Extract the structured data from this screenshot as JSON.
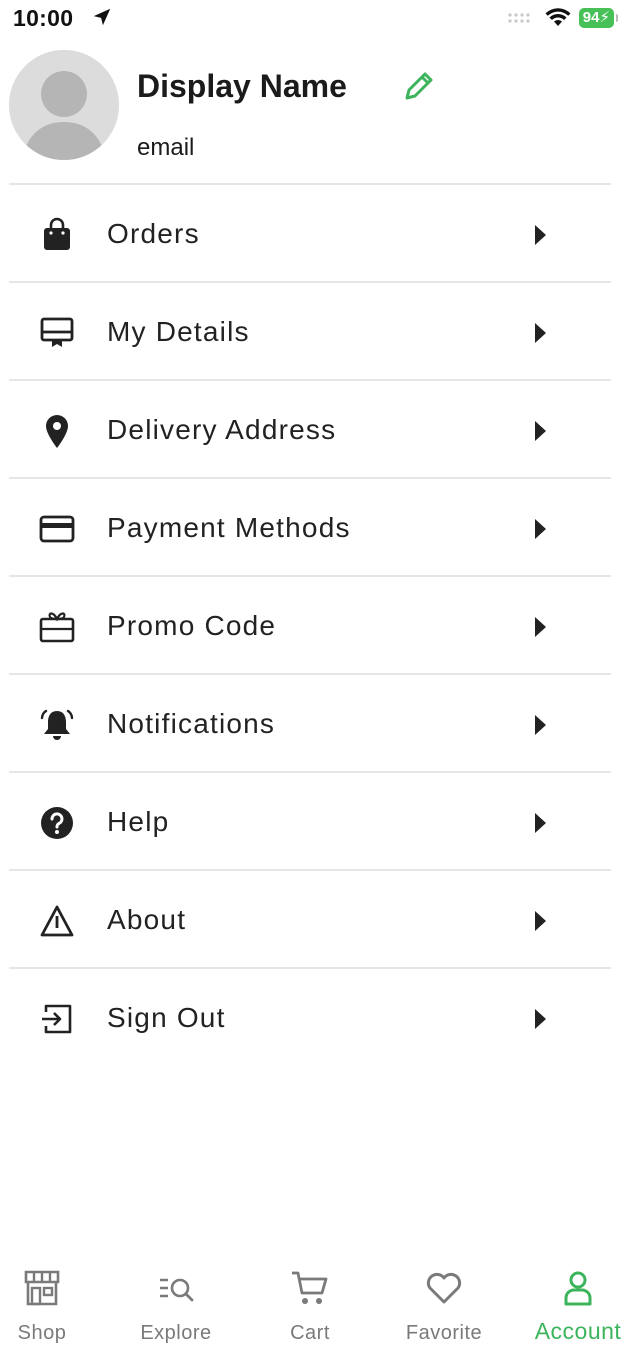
{
  "status_bar": {
    "time": "10:00",
    "battery": "94",
    "icons": [
      "location-arrow-icon",
      "cellular-signal-icon",
      "wifi-icon",
      "battery-icon"
    ]
  },
  "profile": {
    "display_name": "Display Name",
    "email": "email",
    "avatar_icon": "avatar-placeholder-icon",
    "edit_icon": "pencil-icon"
  },
  "menu": {
    "items": [
      {
        "label": "Orders",
        "icon": "shopping-bag-icon"
      },
      {
        "label": "My Details",
        "icon": "id-card-icon"
      },
      {
        "label": "Delivery Address",
        "icon": "map-pin-icon"
      },
      {
        "label": "Payment Methods",
        "icon": "credit-card-icon"
      },
      {
        "label": "Promo Code",
        "icon": "gift-card-icon"
      },
      {
        "label": "Notifications",
        "icon": "bell-icon"
      },
      {
        "label": "Help",
        "icon": "question-circle-icon"
      },
      {
        "label": "About",
        "icon": "warning-triangle-icon"
      },
      {
        "label": "Sign Out",
        "icon": "sign-out-icon"
      }
    ],
    "chevron_icon": "caret-right-icon"
  },
  "tabbar": {
    "tabs": [
      {
        "label": "Shop",
        "icon": "store-icon",
        "active": false
      },
      {
        "label": "Explore",
        "icon": "search-list-icon",
        "active": false
      },
      {
        "label": "Cart",
        "icon": "cart-icon",
        "active": false
      },
      {
        "label": "Favorite",
        "icon": "heart-icon",
        "active": false
      },
      {
        "label": "Account",
        "icon": "user-icon",
        "active": true
      }
    ]
  },
  "colors": {
    "accent": "#3cb45c",
    "battery": "#47c157",
    "text": "#222222",
    "inactive_tab": "#7a7a7a",
    "divider": "#e6e6e6"
  }
}
